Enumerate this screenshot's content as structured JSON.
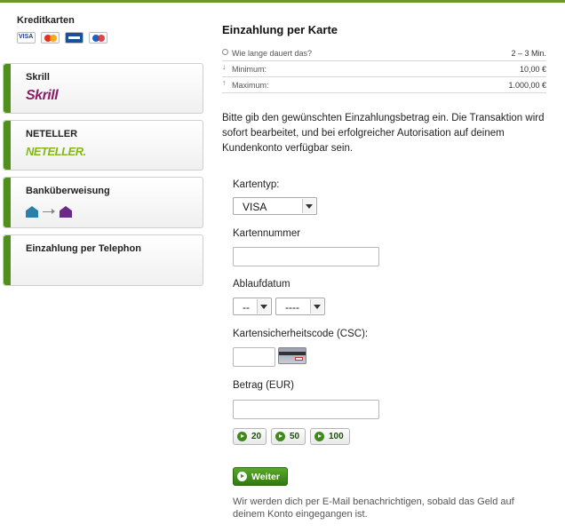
{
  "methods": [
    {
      "title": "Kreditkarten",
      "logos": [
        "visa-icon",
        "mastercard-icon",
        "visa-electron-icon",
        "maestro-icon"
      ],
      "active": true
    },
    {
      "title": "Skrill",
      "logo_text": "Skrill"
    },
    {
      "title": "NETELLER",
      "logo_text": "NETELLER."
    },
    {
      "title": "Banküberweisung",
      "logos": [
        "bank-house-icon",
        "arrow-right-icon",
        "bank-house-icon"
      ]
    },
    {
      "title": "Einzahlung per Telephon"
    }
  ],
  "panel": {
    "heading": "Einzahlung per Karte",
    "info": [
      {
        "icon": "clock-icon",
        "label": "Wie lange dauert das?",
        "value": "2 – 3 Min."
      },
      {
        "icon": "arrow-down-icon",
        "label": "Minimum:",
        "value": "10,00 €"
      },
      {
        "icon": "arrow-up-icon",
        "label": "Maximum:",
        "value": "1.000,00 €"
      }
    ],
    "description": "Bitte gib den gewünschten Einzahlungsbetrag ein. Die Transaktion wird sofort bearbeitet, und bei erfolgreicher Autorisation auf deinem Kundenkonto verfügbar sein."
  },
  "form": {
    "card_type_label": "Kartentyp:",
    "card_type_value": "VISA",
    "card_number_label": "Kartennummer",
    "card_number_value": "",
    "expiry_label": "Ablaufdatum",
    "expiry_month": "--",
    "expiry_year": "----",
    "csc_label": "Kartensicherheitscode (CSC):",
    "csc_value": "",
    "amount_label": "Betrag (EUR)",
    "amount_value": "",
    "quick_amounts": [
      "20",
      "50",
      "100"
    ],
    "submit_label": "Weiter",
    "note": "Wir werden dich per E-Mail benachrichtigen, sobald das Geld auf deinem Konto eingegangen ist."
  },
  "colors": {
    "accent": "#4f8f1a",
    "button": "#3f8a1a",
    "skrill": "#8a1d6a",
    "neteller": "#83b81a"
  }
}
